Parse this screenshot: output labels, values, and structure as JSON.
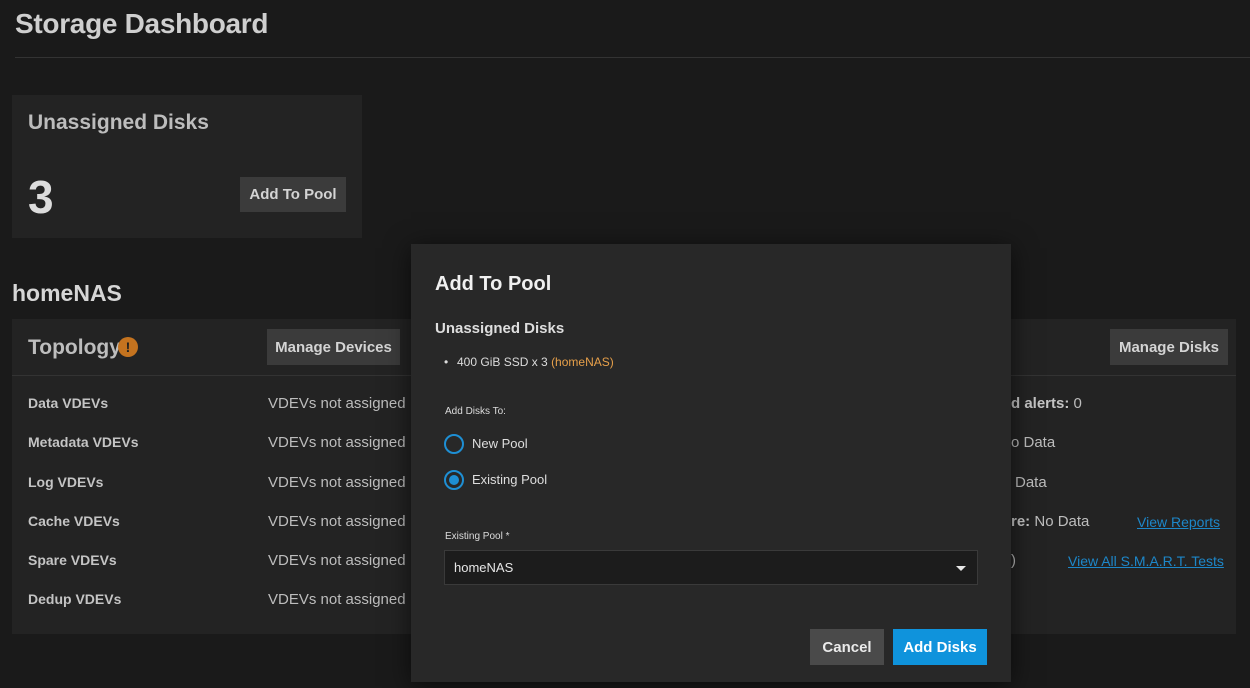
{
  "header": {
    "title": "Storage Dashboard"
  },
  "unassigned_card": {
    "title": "Unassigned Disks",
    "count": "3",
    "add_button": "Add To Pool"
  },
  "pool": {
    "name": "homeNAS"
  },
  "topology": {
    "title": "Topology",
    "warning_icon": "alert-circle-icon",
    "warning_glyph": "!",
    "manage_devices": "Manage Devices",
    "manage_disks": "Manage Disks",
    "rows": [
      {
        "label": "Data VDEVs",
        "value": "VDEVs not assigned"
      },
      {
        "label": "Metadata VDEVs",
        "value": "VDEVs not assigned"
      },
      {
        "label": "Log VDEVs",
        "value": "VDEVs not assigned"
      },
      {
        "label": "Cache VDEVs",
        "value": "VDEVs not assigned"
      },
      {
        "label": "Spare VDEVs",
        "value": "VDEVs not assigned"
      },
      {
        "label": "Dedup VDEVs",
        "value": "VDEVs not assigned"
      }
    ]
  },
  "disk_health_partial": {
    "alerts_label": "d alerts:",
    "alerts_value": "0",
    "row2": "o Data",
    "row3": "Data",
    "row4_label": "re:",
    "row4_value": "No Data",
    "row5": ")",
    "view_reports": "View Reports",
    "view_smart": "View All S.M.A.R.T. Tests"
  },
  "dialog": {
    "title": "Add To Pool",
    "subtitle": "Unassigned Disks",
    "disk_bullet": "•",
    "disk_entry": "400 GiB SSD x 3",
    "disk_pool": "(homeNAS)",
    "add_to_label": "Add Disks To:",
    "option_new": "New Pool",
    "option_existing": "Existing Pool",
    "selected_option": "Existing Pool",
    "existing_pool_label": "Existing Pool *",
    "existing_pool_value": "homeNAS",
    "cancel": "Cancel",
    "submit": "Add Disks"
  },
  "colors": {
    "accent": "#0f93dc",
    "warning": "#c4731f",
    "pool_highlight": "#e7a04a"
  }
}
